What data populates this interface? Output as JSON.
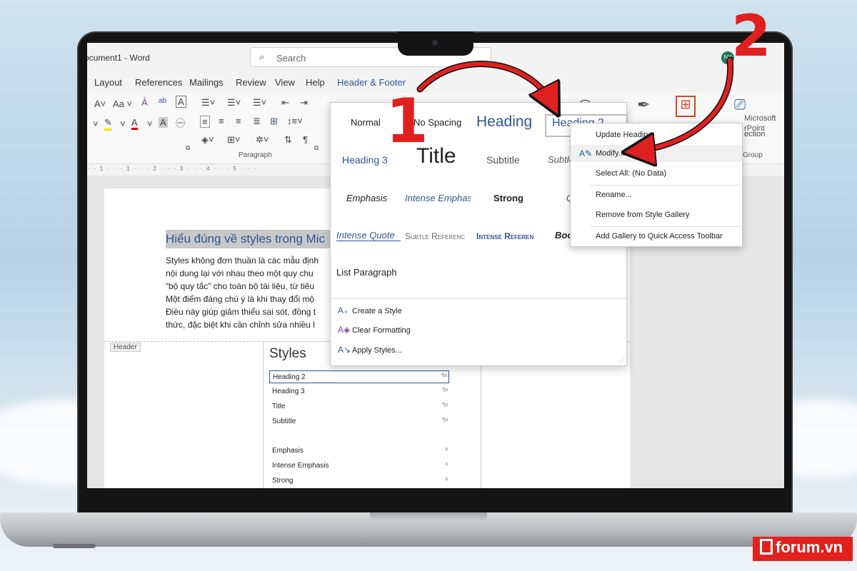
{
  "window": {
    "title": "ocument1 - Word",
    "avatar": "NY"
  },
  "search": {
    "placeholder": "Search"
  },
  "tabs": [
    {
      "label": "Layout"
    },
    {
      "label": "References"
    },
    {
      "label": "Mailings"
    },
    {
      "label": "Review"
    },
    {
      "label": "View"
    },
    {
      "label": "Help"
    },
    {
      "label": "Header & Footer",
      "active": true
    }
  ],
  "ribbon": {
    "paragraph_label": "Paragraph",
    "group_label": "Group",
    "microsoft_label": "Microsoft",
    "powerpoint_label": "rPoint"
  },
  "ruler": "· · 1 · · · 1 · · · 2 · · · 3 · · · 4 · · · 5 · · ·",
  "document": {
    "heading": "Hiểu đúng về styles trong Mic",
    "paragraph_lines": [
      "Styles không đơn thuần là các mẫu định",
      "nội dung lại với nhau theo một quy chu",
      "“bộ quy tắc” cho toàn bộ tài liệu, từ tiêu",
      "Một điểm đáng chú ý là khi thay đổi mộ",
      "Điều này giúp giảm thiểu sai sót, đồng t",
      "thức, đặc biệt khi cần chỉnh sửa nhiều l"
    ],
    "header_tag": "Header"
  },
  "styles_pane": {
    "title": "Styles",
    "items": [
      {
        "label": "Heading 2",
        "mark": "¶a",
        "selected": true
      },
      {
        "label": "Heading 3",
        "mark": "¶a"
      },
      {
        "label": "Title",
        "mark": "¶a"
      },
      {
        "label": "Subtitle",
        "mark": "¶a"
      },
      {
        "label": "Emphasis",
        "mark": "a"
      },
      {
        "label": "Intense Emphasis",
        "mark": "a"
      },
      {
        "label": "Strong",
        "mark": "a"
      }
    ]
  },
  "gallery": {
    "styles": [
      {
        "label": "Normal"
      },
      {
        "label": "No Spacing"
      },
      {
        "label": "Heading"
      },
      {
        "label": "Heading 2",
        "selected": true
      },
      {
        "label": "Heading 3"
      },
      {
        "label": "Title"
      },
      {
        "label": "Subtitle"
      },
      {
        "label": "Subtle"
      },
      {
        "label": "Emphasis"
      },
      {
        "label": "Intense Emphas"
      },
      {
        "label": "Strong"
      },
      {
        "label": "Q"
      },
      {
        "label": "Intense Quote"
      },
      {
        "label": "Subtle Referenc"
      },
      {
        "label": "Intense Referen"
      },
      {
        "label": "Boo"
      },
      {
        "label": "List Paragraph"
      }
    ],
    "commands": [
      {
        "label": "Create a Style",
        "icon": "create-style-icon"
      },
      {
        "label": "Clear Formatting",
        "icon": "clear-formatting-icon"
      },
      {
        "label": "Apply Styles...",
        "icon": "apply-styles-icon"
      }
    ]
  },
  "context_menu": {
    "items": [
      {
        "label": "Update Headin"
      },
      {
        "label": "Modify...",
        "icon": "modify-style-icon",
        "highlighted": true
      },
      {
        "label": "Select All: (No Data)"
      },
      {
        "label": "Rename..."
      },
      {
        "label": "Remove from Style Gallery"
      },
      {
        "label": "Add Gallery to Quick Access Toolbar"
      }
    ],
    "partial_behind": "ection"
  },
  "annotations": {
    "step1": "1",
    "step2": "2",
    "arrow_color": "#e02020"
  },
  "watermark": {
    "text": "forum.vn",
    "color": "#e2211c"
  }
}
